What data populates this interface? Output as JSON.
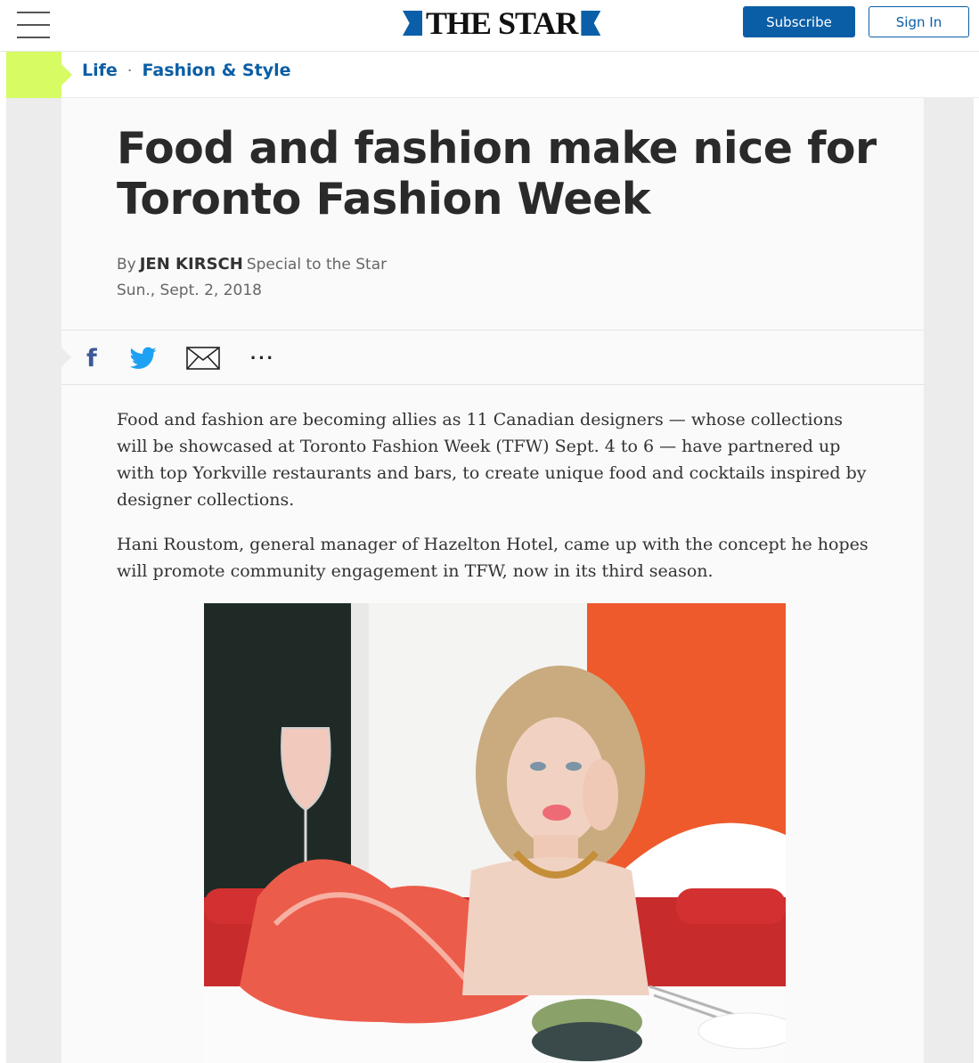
{
  "header": {
    "logo_text": "THE STAR",
    "subscribe_label": "Subscribe",
    "signin_label": "Sign In",
    "brand_color": "#0a5ea6"
  },
  "breadcrumb": {
    "items": [
      {
        "label": "Life"
      },
      {
        "label": "Fashion & Style"
      }
    ],
    "separator": "·",
    "accent_color": "#d6fb63"
  },
  "article": {
    "headline": "Food and fashion make nice for Toronto Fashion Week",
    "byline_prefix": "By",
    "author": "JEN KIRSCH",
    "byline_suffix": "Special to the Star",
    "date": "Sun., Sept. 2, 2018",
    "paragraphs": [
      "Food and fashion are becoming allies as 11 Canadian designers — whose collections will be showcased at Toronto Fashion Week (TFW) Sept. 4 to 6 — have partnered up with top Yorkville restaurants and bars, to create unique food and cocktails inspired by designer collections.",
      "Hani Roustom, general manager of Hazelton Hotel, came up with the concept he hopes will promote community engagement in TFW, now in its third season."
    ]
  },
  "share": {
    "icons": [
      "facebook-icon",
      "twitter-icon",
      "email-icon",
      "more-icon"
    ],
    "facebook_glyph": "f",
    "more_glyph": "···"
  }
}
